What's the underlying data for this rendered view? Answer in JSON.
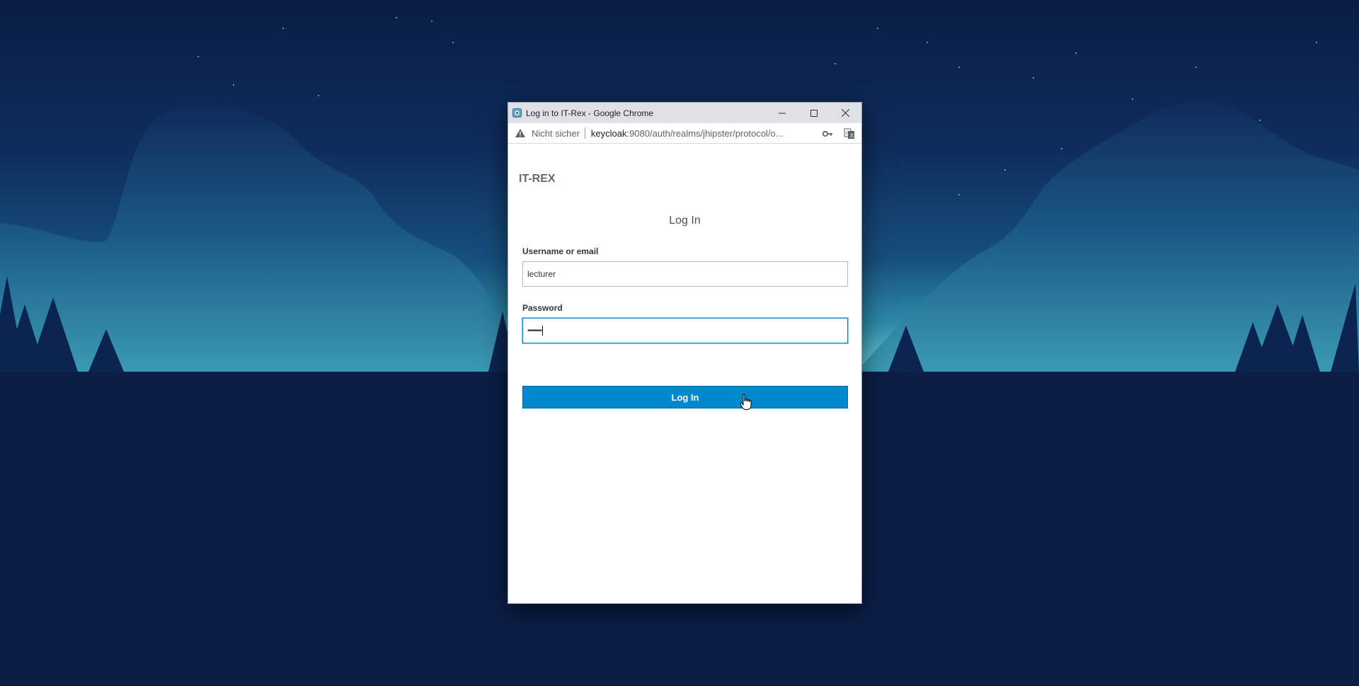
{
  "window": {
    "title": "Log in to IT-Rex - Google Chrome",
    "app_icon": "chrome-app-icon",
    "controls": [
      "minimize-icon",
      "maximize-icon",
      "close-icon"
    ]
  },
  "addressbar": {
    "security_icon": "warning-icon",
    "security_label": "Nicht sicher",
    "url_host": "keycloak",
    "url_rest": ":9080/auth/realms/jhipster/protocol/o...",
    "key_icon": "key-icon",
    "translate_icon": "translate-icon"
  },
  "page": {
    "brand": "IT-REX",
    "heading": "Log In",
    "username": {
      "label": "Username or email",
      "value": "lecturer"
    },
    "password": {
      "label": "Password",
      "value": "••••••••"
    },
    "login_button": "Log In"
  },
  "colors": {
    "desktop_bg": "#0b1e47",
    "primary_button": "#0088ce",
    "focus_border": "#0088ce"
  }
}
